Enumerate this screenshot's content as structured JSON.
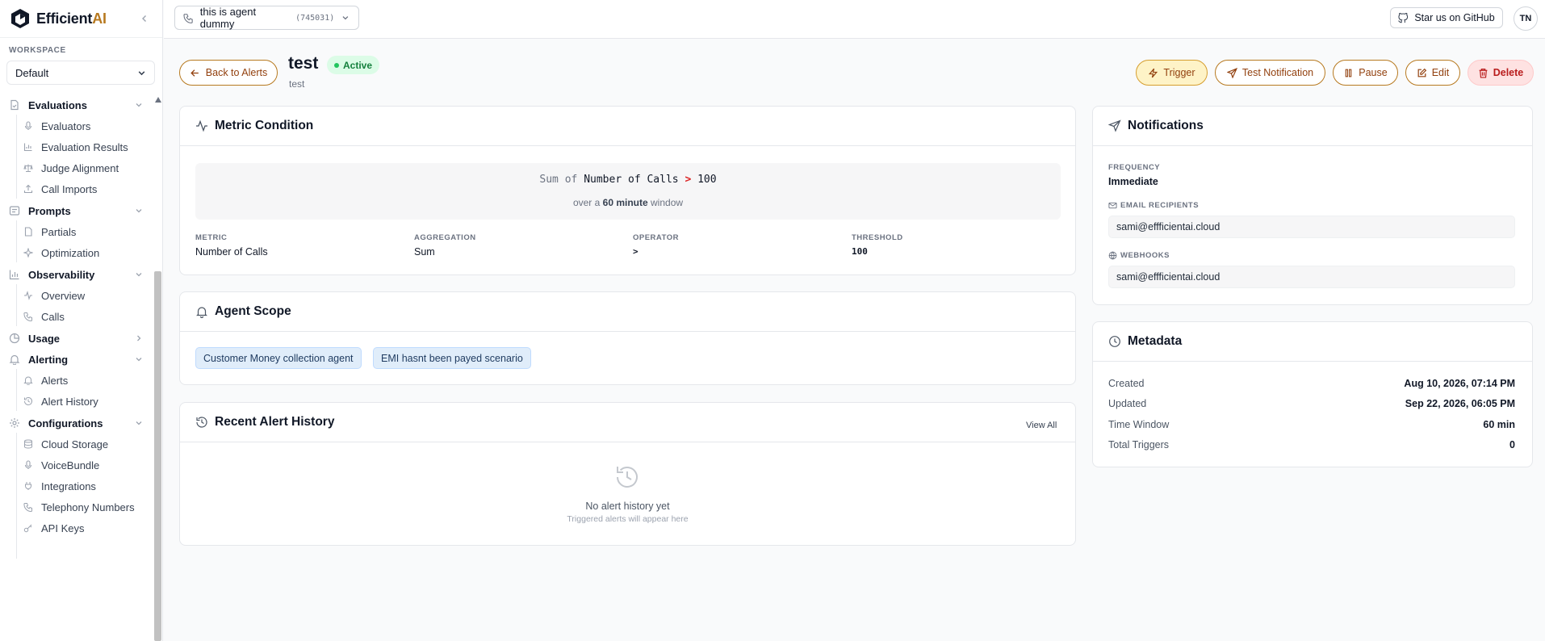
{
  "app": {
    "name_main": "Efficient",
    "name_accent": "AI"
  },
  "workspace": {
    "label": "WORKSPACE",
    "selected": "Default"
  },
  "nav": {
    "evaluations": "Evaluations",
    "evaluators": "Evaluators",
    "evaluation_results": "Evaluation Results",
    "judge_alignment": "Judge Alignment",
    "call_imports": "Call Imports",
    "prompts": "Prompts",
    "partials": "Partials",
    "optimization": "Optimization",
    "observability": "Observability",
    "overview": "Overview",
    "calls": "Calls",
    "usage": "Usage",
    "alerting": "Alerting",
    "alerts": "Alerts",
    "alert_history": "Alert History",
    "configurations": "Configurations",
    "cloud_storage": "Cloud Storage",
    "voicebundle": "VoiceBundle",
    "integrations": "Integrations",
    "telephony_numbers": "Telephony Numbers",
    "api_keys": "API Keys"
  },
  "topbar": {
    "agent_name": "this is agent dummy",
    "agent_id": "(745031)",
    "github_label": "Star us on GitHub",
    "avatar_initials": "TN"
  },
  "header": {
    "back_label": "Back to Alerts",
    "title": "test",
    "subtitle": "test",
    "status": "Active",
    "actions": {
      "trigger": "Trigger",
      "test_notification": "Test Notification",
      "pause": "Pause",
      "edit": "Edit",
      "delete": "Delete"
    }
  },
  "metric_condition": {
    "title": "Metric Condition",
    "formula": {
      "agg": "Sum",
      "of": "of",
      "metric": "Number of Calls",
      "op": ">",
      "threshold": "100"
    },
    "window": {
      "prefix": "over a",
      "value": "60 minute",
      "suffix": "window"
    },
    "fields": [
      {
        "label": "METRIC",
        "value": "Number of Calls"
      },
      {
        "label": "AGGREGATION",
        "value": "Sum"
      },
      {
        "label": "OPERATOR",
        "value": ">"
      },
      {
        "label": "THRESHOLD",
        "value": "100"
      }
    ]
  },
  "agent_scope": {
    "title": "Agent Scope",
    "agents": [
      "Customer Money collection agent",
      "EMI hasnt been payed scenario"
    ]
  },
  "history": {
    "title": "Recent Alert History",
    "view_all": "View All",
    "empty_title": "No alert history yet",
    "empty_subtitle": "Triggered alerts will appear here"
  },
  "notifications": {
    "title": "Notifications",
    "frequency_label": "FREQUENCY",
    "frequency_value": "Immediate",
    "email_label": "EMAIL RECIPIENTS",
    "email_value": "sami@effficientai.cloud",
    "webhooks_label": "WEBHOOKS",
    "webhooks_value": "sami@effficientai.cloud"
  },
  "metadata": {
    "title": "Metadata",
    "rows": [
      {
        "key": "Created",
        "value": "Aug 10, 2026, 07:14 PM"
      },
      {
        "key": "Updated",
        "value": "Sep 22, 2026, 06:05 PM"
      },
      {
        "key": "Time Window",
        "value": "60 min"
      },
      {
        "key": "Total Triggers",
        "value": "0"
      }
    ]
  },
  "colors": {
    "accent": "#b7791f",
    "active": "#15803d",
    "danger": "#b91c1c",
    "tag_bg": "#e0edfa"
  }
}
